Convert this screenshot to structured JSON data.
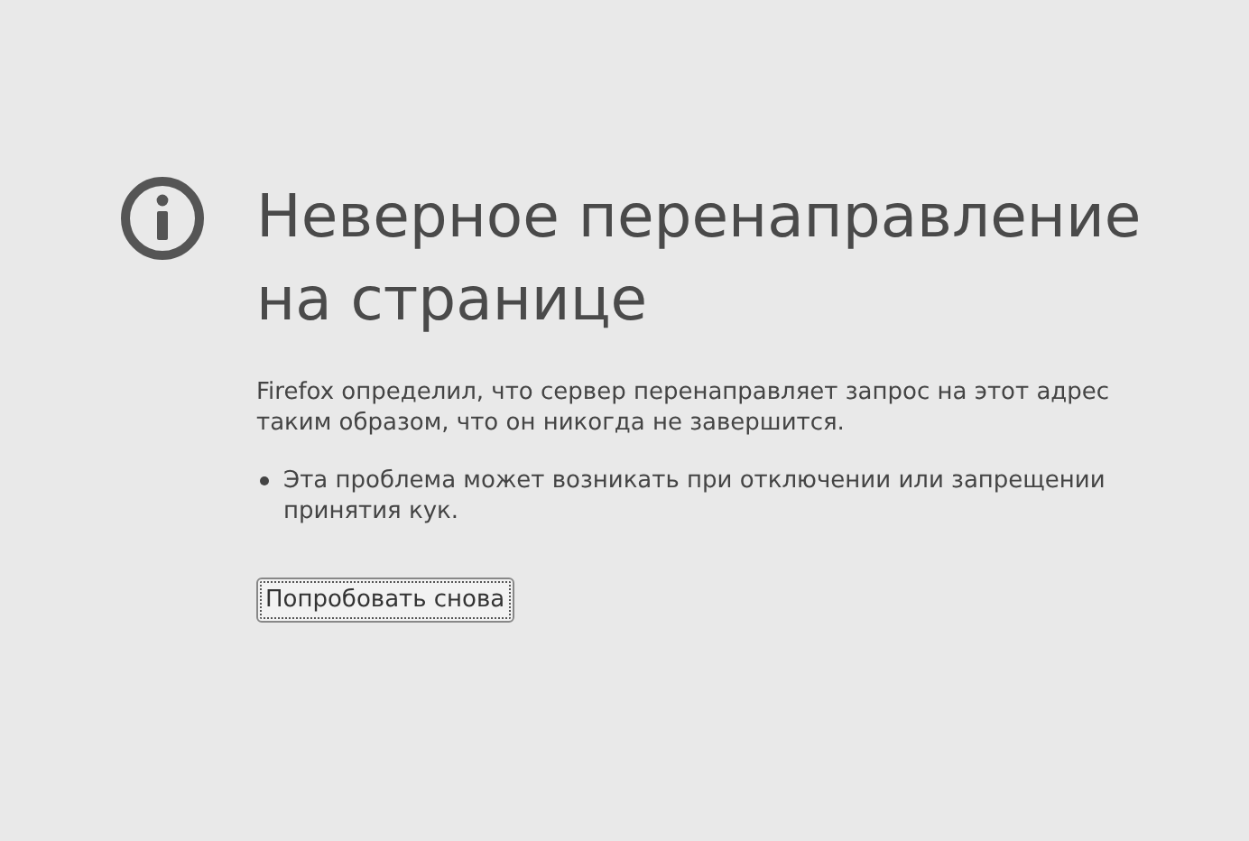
{
  "title": "Неверное перенаправление на странице",
  "description": "Firefox определил, что сервер перенаправляет запрос на этот адрес таким образом, что он никогда не завершится.",
  "bullets": [
    "Эта проблема может возникать при отключении или запрещении принятия кук."
  ],
  "button": "Попробовать снова"
}
